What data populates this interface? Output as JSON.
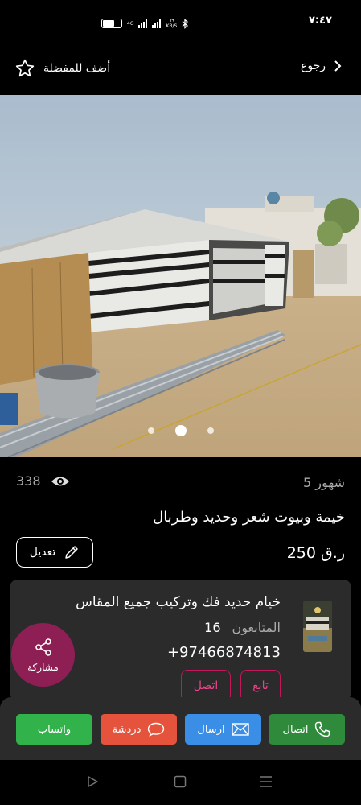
{
  "status_bar": {
    "time": "٧:٤٧",
    "net_speed": "٦٩",
    "speed_unit": "KB/S",
    "network": "4G"
  },
  "nav": {
    "back_label": "رجوع",
    "favorite_label": "أضف للمفضلة"
  },
  "listing": {
    "views": "338",
    "age": "5 شهور",
    "title": "خيمة وبيوت شعر وحديد وطربال",
    "price": "250 ر.ق",
    "edit_label": "تعديل",
    "image_count": 3,
    "active_image": 1
  },
  "seller": {
    "name": "خيام حديد فك وتركيب جميع المقاس",
    "followers_label": "المتابعون",
    "followers_count": "16",
    "phone": "+97466874813",
    "follow_label": "تابع",
    "call_label": "اتصل"
  },
  "share_label": "مشاركة",
  "actions": {
    "call": "اتصال",
    "send": "ارسال",
    "chat": "دردشة",
    "whatsapp": "واتساب"
  },
  "colors": {
    "background": "#000000",
    "card": "#2b2b2b",
    "accent_pink": "#c2185b",
    "share_fab": "#8e1f55",
    "whatsapp": "#32b24a",
    "chat": "#e5533d",
    "send": "#3a8ee6",
    "call": "#2f8a3b"
  }
}
